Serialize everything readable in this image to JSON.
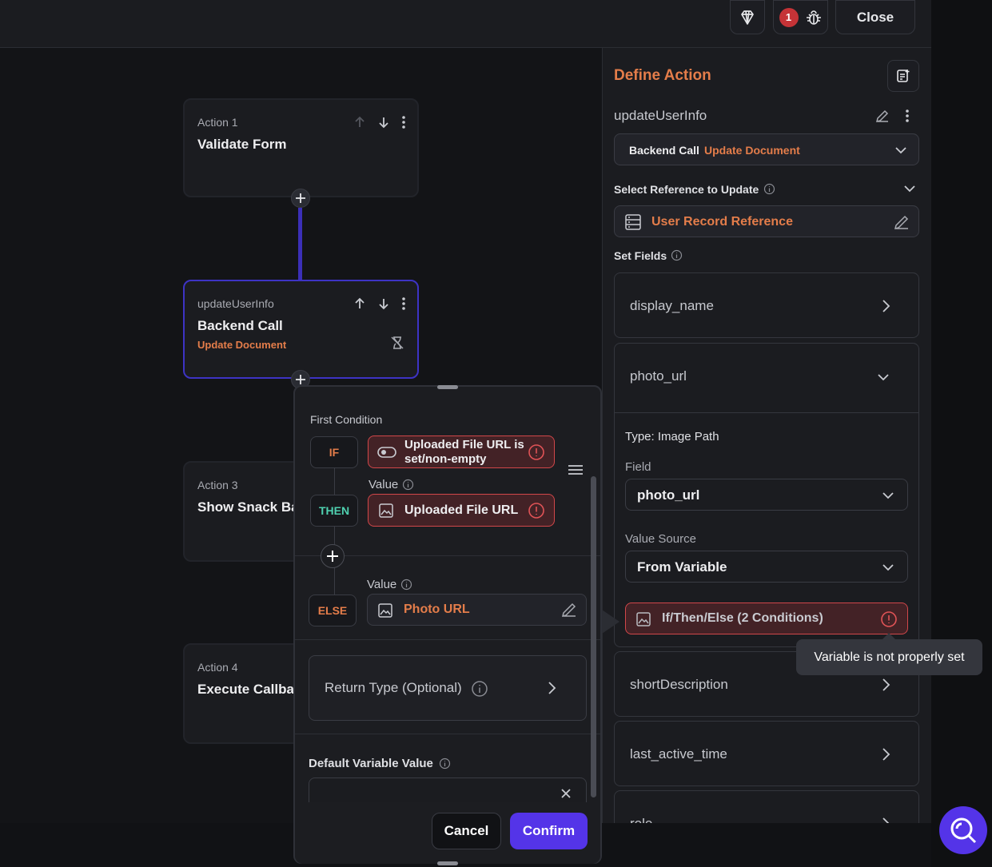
{
  "topbar": {
    "error_count": "1",
    "close_label": "Close"
  },
  "actions": [
    {
      "sub": "Action 1",
      "title": "Validate Form"
    },
    {
      "sub": "updateUserInfo",
      "title": "Backend Call",
      "accent": "Update Document"
    },
    {
      "sub": "Action 3",
      "title": "Show Snack Ba"
    },
    {
      "sub": "Action 4",
      "title": "Execute Callba"
    }
  ],
  "panel": {
    "title": "Define Action",
    "action_name": "updateUserInfo",
    "type_label": "Backend Call",
    "type_value": "Update Document",
    "ref_label": "Select Reference to Update",
    "ref_value": "User Record Reference",
    "set_fields_label": "Set Fields",
    "fields": [
      "display_name",
      "photo_url",
      "shortDescription",
      "last_active_time",
      "role"
    ],
    "photo": {
      "type_text": "Type: Image Path",
      "field_label": "Field",
      "field_value": "photo_url",
      "source_label": "Value Source",
      "source_value": "From Variable",
      "var_value": "If/Then/Else (2 Conditions)"
    }
  },
  "tooltip": "Variable is not properly set",
  "popup": {
    "first_condition": "First Condition",
    "if_tag": "IF",
    "if_value": "Uploaded File URL is set/non-empty",
    "value_label": "Value",
    "then_tag": "THEN",
    "then_value": "Uploaded File URL",
    "else_tag": "ELSE",
    "else_value": "Photo URL",
    "return_type": "Return Type (Optional)",
    "default_label": "Default Variable Value",
    "cancel": "Cancel",
    "confirm": "Confirm"
  },
  "colors": {
    "accent": "#e47d4a",
    "primary": "#5434e8",
    "error": "#d1474a",
    "connector": "#3b2fb8"
  }
}
